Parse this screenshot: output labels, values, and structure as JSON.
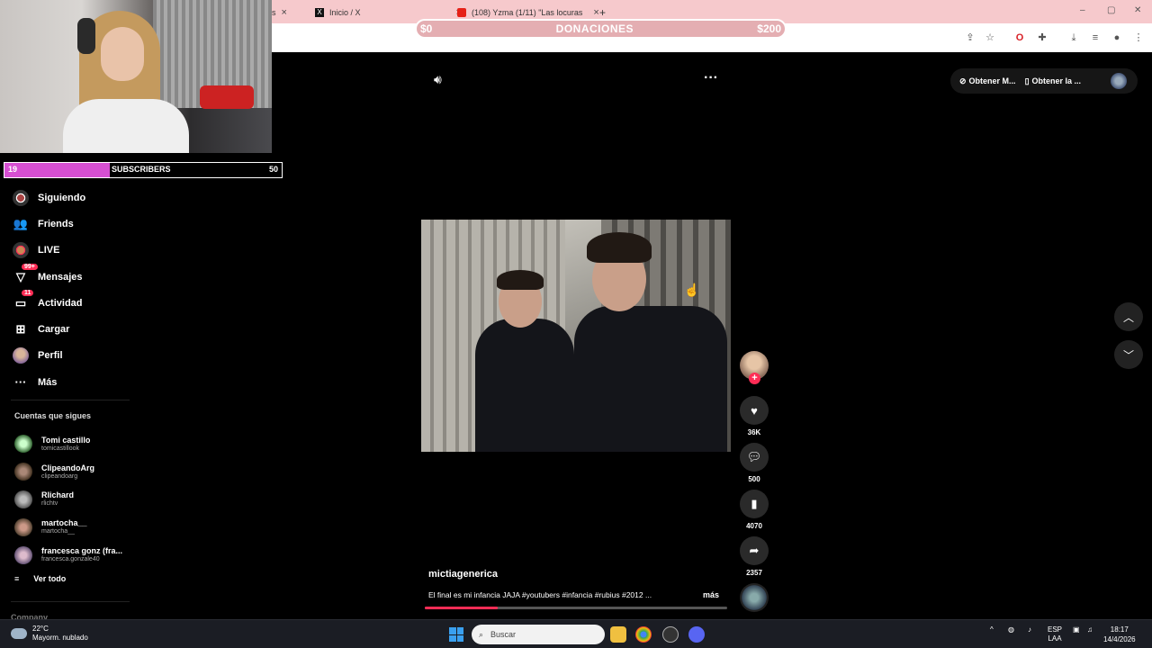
{
  "browser": {
    "tabs": [
      {
        "label": "s",
        "favicon": "tiktok"
      },
      {
        "label": "Inicio / X",
        "favicon": "x"
      },
      {
        "label": "(108) Yzma (1/11) \"Las locuras",
        "favicon": "youtube"
      }
    ],
    "new_tab": "+",
    "window_controls": [
      "–",
      "▢",
      "✕"
    ]
  },
  "donation": {
    "min": "$0",
    "title": "DONACIONES",
    "max": "$200"
  },
  "subscribers": {
    "current": "19",
    "label": "SUBSCRIBERS",
    "goal": "50",
    "progress_fraction": 0.38,
    "fill_color": "#d64fd2"
  },
  "nav": {
    "items": [
      {
        "label": "Siguiendo",
        "icon": "following-avatar-icon"
      },
      {
        "label": "Friends",
        "icon": "friends-icon"
      },
      {
        "label": "LIVE",
        "icon": "live-icon"
      },
      {
        "label": "Mensajes",
        "icon": "messages-icon",
        "badge": "99+"
      },
      {
        "label": "Actividad",
        "icon": "activity-icon",
        "badge": "11"
      },
      {
        "label": "Cargar",
        "icon": "upload-icon"
      },
      {
        "label": "Perfil",
        "icon": "profile-avatar-icon"
      },
      {
        "label": "Más",
        "icon": "more-icon"
      }
    ]
  },
  "following": {
    "title": "Cuentas que sigues",
    "accounts": [
      {
        "name": "Tomi castillo",
        "handle": "tomicastillook"
      },
      {
        "name": "ClipeandoArg",
        "handle": "clipeandoarg"
      },
      {
        "name": "Rlichard",
        "handle": "rlichtv"
      },
      {
        "name": "martocha__",
        "handle": "martocha__"
      },
      {
        "name": "francesca gonz (fra...",
        "handle": "francesca.gonzale40"
      }
    ],
    "see_all": "Ver todo",
    "company": "Company"
  },
  "video": {
    "username": "mictiagenerica",
    "caption": "El final es mi infancia JAJA #youtubers #infancia #rubius #2012 ...",
    "more": "más",
    "progress_fraction": 0.24,
    "likes": "36K",
    "comments": "500",
    "saves": "4070",
    "shares": "2357",
    "follow_plus": "+"
  },
  "top_right": {
    "get_app_1": "Obtener M...",
    "get_app_2": "Obtener la ..."
  },
  "taskbar": {
    "temperature": "22°C",
    "weather": "Mayorm. nublado",
    "search_placeholder": "Buscar",
    "lang_1": "ESP",
    "lang_2": "LAA",
    "time": "18:17",
    "date": "14/4/2026"
  },
  "colors": {
    "accent": "#fe2c55",
    "tab_bar": "#f6c9cc",
    "donation_bar": "#e4aeb2"
  }
}
